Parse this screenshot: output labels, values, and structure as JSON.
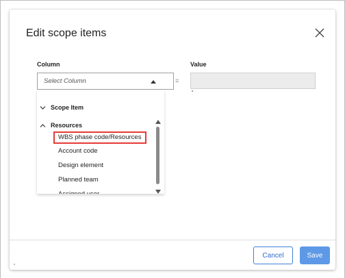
{
  "dialog": {
    "title": "Edit scope items",
    "close_icon": "close-icon"
  },
  "form": {
    "column_label": "Column",
    "value_label": "Value",
    "operator": "=",
    "column_select": {
      "placeholder": "Select Column",
      "arrow_icon": "caret-up-icon"
    },
    "value_input": {
      "value": ""
    }
  },
  "dropdown": {
    "groups": [
      {
        "label": "Scope Item",
        "expanded": false,
        "icon": "chevron-down-icon"
      },
      {
        "label": "Resources",
        "expanded": true,
        "icon": "chevron-up-icon"
      }
    ],
    "options": [
      {
        "label": "WBS phase code/Resources",
        "highlighted": true
      },
      {
        "label": "Account code",
        "highlighted": false
      },
      {
        "label": "Design element",
        "highlighted": false
      },
      {
        "label": "Planned team",
        "highlighted": false
      },
      {
        "label": "Assigned user",
        "highlighted": false
      }
    ]
  },
  "footer": {
    "cancel_label": "Cancel",
    "save_label": "Save"
  },
  "colors": {
    "primary": "#5d99e6",
    "primary_border": "#3f7fd6",
    "highlight_border": "#e53935",
    "input_disabled_bg": "#ececec"
  }
}
